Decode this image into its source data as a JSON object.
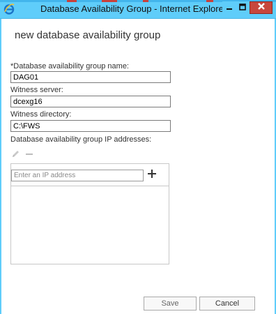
{
  "window": {
    "title": "Database Availability Group - Internet Explorer",
    "app_icon": "internet-explorer-icon",
    "controls": {
      "minimize_icon": "minimize-icon",
      "maximize_icon": "maximize-icon",
      "close_icon": "close-icon"
    },
    "colors": {
      "titlebar": "#5fcdfa",
      "close_button": "#c7473d"
    }
  },
  "form": {
    "heading": "new database availability group",
    "dag_name": {
      "label": "*Database availability group name:",
      "value": "DAG01"
    },
    "witness_server": {
      "label": "Witness server:",
      "value": "dcexg16"
    },
    "witness_directory": {
      "label": "Witness directory:",
      "value": "C:\\FWS"
    },
    "ip_addresses": {
      "label": "Database availability group IP addresses:",
      "edit_icon": "pencil-icon",
      "remove_icon": "minus-icon",
      "add_icon": "plus-icon",
      "placeholder": "Enter an IP address",
      "value": ""
    }
  },
  "actions": {
    "save_label": "Save",
    "cancel_label": "Cancel"
  }
}
